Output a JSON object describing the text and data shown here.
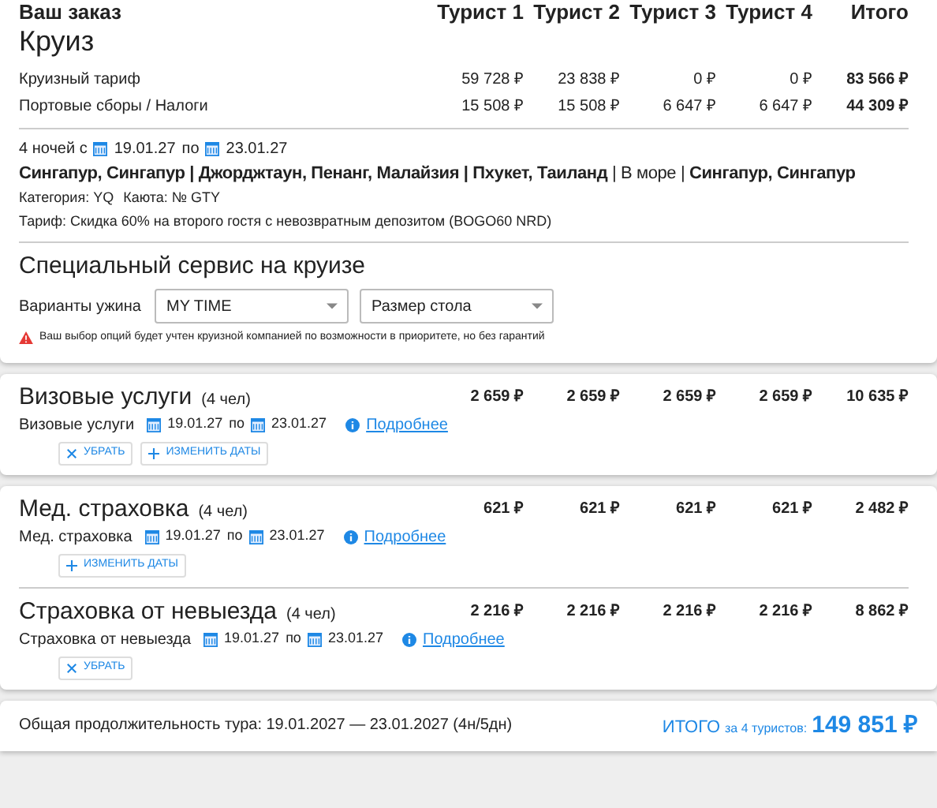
{
  "order": {
    "title": "Ваш заказ",
    "subtitle": "Круиз",
    "columns": [
      "Турист 1",
      "Турист 2",
      "Турист 3",
      "Турист 4",
      "Итого"
    ],
    "rows": [
      {
        "label": "Круизный тариф",
        "values": [
          "59 728 ₽",
          "23 838 ₽",
          "0 ₽",
          "0 ₽",
          "83 566 ₽"
        ]
      },
      {
        "label": "Портовые сборы / Налоги",
        "values": [
          "15 508 ₽",
          "15 508 ₽",
          "6 647 ₽",
          "6 647 ₽",
          "44 309 ₽"
        ]
      }
    ],
    "nights": "4 ночей с",
    "date_from": "19.01.27",
    "date_sep": "по",
    "date_to": "23.01.27",
    "route": "**Сингапур, Сингапур | Джорджтаун, Пенанг, Малайзия | Пхукет, Таиланд** | В море | **Сингапур, Сингапур**",
    "category": "Категория: YQ",
    "cabin": "Каюта: № GTY",
    "tariff": "Тариф: Скидка 60% на второго гостя с невозвратным депозитом (BOGO60 NRD)"
  },
  "special": {
    "title": "Специальный сервис на круизе",
    "label": "Варианты ужина",
    "selects": [
      {
        "value": "MY TIME"
      },
      {
        "value": "Размер стола"
      }
    ],
    "warning": "Ваш выбор опций будет учтен круизной компанией по возможности в приоритете, но без гарантий"
  },
  "cards": [
    {
      "services": [
        {
          "title": "Визовые услуги",
          "count": "(4 чел)",
          "values": [
            "2 659 ₽",
            "2 659 ₽",
            "2 659 ₽",
            "2 659 ₽",
            "10 635 ₽"
          ],
          "label": "Визовые услуги",
          "date_from": "19.01.27",
          "date_sep": "по",
          "date_to": "23.01.27",
          "link": "Подробнее",
          "buttons": [
            {
              "kind": "remove",
              "label": "УБРАТЬ"
            },
            {
              "kind": "dates",
              "label": "ИЗМЕНИТЬ ДАТЫ"
            }
          ]
        }
      ]
    },
    {
      "services": [
        {
          "title": "Мед. страховка",
          "count": "(4 чел)",
          "values": [
            "621 ₽",
            "621 ₽",
            "621 ₽",
            "621 ₽",
            "2 482 ₽"
          ],
          "label": "Мед. страховка",
          "date_from": "19.01.27",
          "date_sep": "по",
          "date_to": "23.01.27",
          "link": "Подробнее",
          "buttons": [
            {
              "kind": "dates",
              "label": "ИЗМЕНИТЬ ДАТЫ"
            }
          ]
        },
        {
          "title": "Страховка от невыезда",
          "count": "(4 чел)",
          "values": [
            "2 216 ₽",
            "2 216 ₽",
            "2 216 ₽",
            "2 216 ₽",
            "8 862 ₽"
          ],
          "label": "Страховка от невыезда",
          "date_from": "19.01.27",
          "date_sep": "по",
          "date_to": "23.01.27",
          "link": "Подробнее",
          "buttons": [
            {
              "kind": "remove",
              "label": "УБРАТЬ"
            }
          ]
        }
      ]
    }
  ],
  "footer": {
    "duration": "Общая продолжительность тура: 19.01.2027 — 23.01.2027 (4н/5дн)",
    "total_label": "ИТОГО",
    "total_for": "за 4 туристов:",
    "total": "149 851 ₽"
  }
}
